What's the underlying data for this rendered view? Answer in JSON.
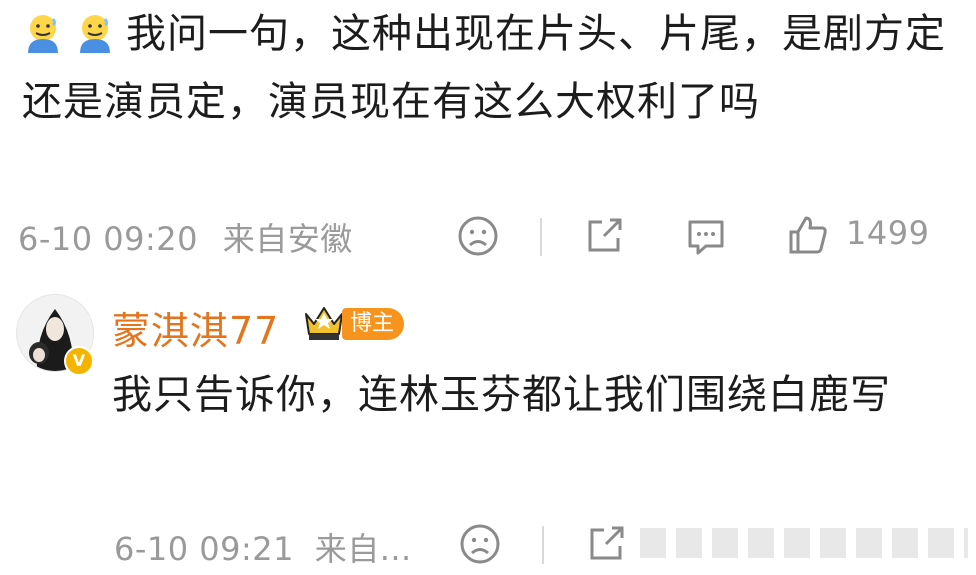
{
  "comment1": {
    "emoji_icon": "sweating-face-emoji",
    "text": "我问一句，这种出现在片头、片尾，是剧方定还是演员定，演员现在有这么大权利了吗",
    "time": "6-10 09:20",
    "source": "来自安徽",
    "like_count": "1499"
  },
  "comment2": {
    "avatar_icon": "user-avatar",
    "verified_icon": "verified-v-badge",
    "username": "蒙淇淇77",
    "crown_icon": "crown-level-ii-badge",
    "badge": "博主",
    "text": "我只告诉你，连林玉芬都让我们围绕白鹿写",
    "time": "6-10 09:21",
    "source": "来自..."
  },
  "colors": {
    "username": "#e3751e",
    "badge": "#f7941e",
    "meta": "#9a9a9a",
    "icon": "#8a8a8a"
  }
}
